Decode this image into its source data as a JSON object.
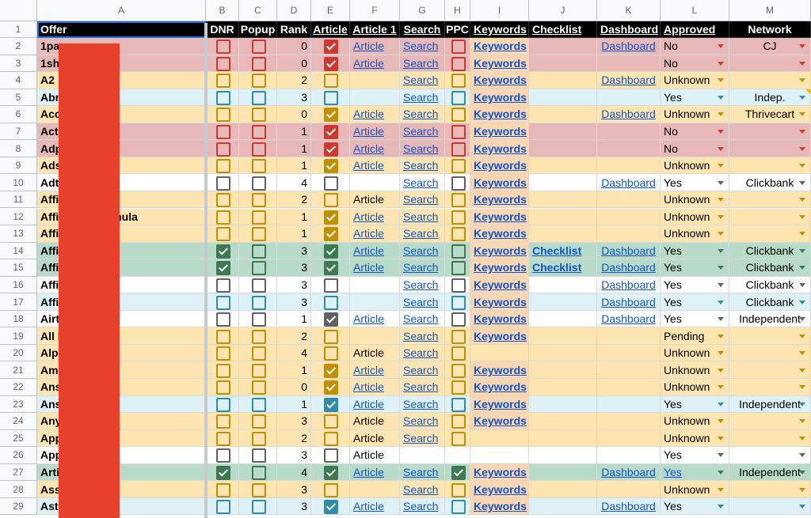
{
  "colors": {
    "red": "#e6b8b7",
    "yellow": "#fce5b0",
    "blue": "#ddf1f7",
    "green": "#b7dbc8",
    "white": "#ffffff",
    "redact": "#e8402a"
  },
  "checkbox_colors": {
    "red": "#cc3a2f",
    "yellow": "#bf9000",
    "blue": "#2f8dab",
    "green": "#3d7a52",
    "white": "#5f6368"
  },
  "col_letters": [
    "A",
    "B",
    "C",
    "D",
    "E",
    "F",
    "G",
    "H",
    "I",
    "J",
    "K",
    "L",
    "M"
  ],
  "header": [
    "Offer",
    "DNR",
    "Popup",
    "Rank",
    "Article",
    "Article 1",
    "Search",
    "PPC",
    "Keywords",
    "Checklist",
    "Dashboard",
    "Approved",
    "Network"
  ],
  "rows": [
    {
      "n": "2",
      "offer": "1pa",
      "theme": "red",
      "dnr": false,
      "popup": false,
      "rank": "0",
      "art": true,
      "art1": "Article",
      "search": "Search",
      "ppc": false,
      "kw": "Keywords",
      "check": "",
      "dash": "Dashboard",
      "appr": "No",
      "net": "CJ"
    },
    {
      "n": "3",
      "offer": "1sh",
      "theme": "red",
      "dnr": false,
      "popup": false,
      "rank": "0",
      "art": true,
      "art1": "Article",
      "search": "Search",
      "ppc": false,
      "kw": "Keywords",
      "check": "",
      "dash": "",
      "appr": "No",
      "net": ""
    },
    {
      "n": "4",
      "offer": "A2",
      "theme": "yellow",
      "dnr": false,
      "popup": false,
      "rank": "2",
      "art": false,
      "art1": "",
      "search": "Search",
      "ppc": false,
      "kw": "Keywords",
      "check": "",
      "dash": "Dashboard",
      "appr": "Unknown",
      "net": ""
    },
    {
      "n": "5",
      "offer": "Abr",
      "theme": "blue",
      "dnr": false,
      "popup": false,
      "rank": "3",
      "art": false,
      "art1": "",
      "search": "Search",
      "ppc": false,
      "kw": "Keywords",
      "check": "",
      "dash": "",
      "appr": "Yes",
      "net": "Indep."
    },
    {
      "n": "6",
      "offer": "Acc",
      "theme": "yellow",
      "dnr": false,
      "popup": false,
      "rank": "0",
      "art": true,
      "art1": "Article",
      "search": "Search",
      "ppc": false,
      "kw": "Keywords",
      "check": "",
      "dash": "Dashboard",
      "appr": "Unknown",
      "net": "Thrivecart"
    },
    {
      "n": "7",
      "offer": "Act                 gn",
      "theme": "red",
      "dnr": false,
      "popup": false,
      "rank": "1",
      "art": true,
      "art1": "Article",
      "search": "Search",
      "ppc": false,
      "kw": "Keywords",
      "check": "",
      "dash": "",
      "appr": "No",
      "net": ""
    },
    {
      "n": "8",
      "offer": "Adp",
      "theme": "red",
      "dnr": false,
      "popup": false,
      "rank": "1",
      "art": true,
      "art1": "Article",
      "search": "Search",
      "ppc": false,
      "kw": "Keywords",
      "check": "",
      "dash": "",
      "appr": "No",
      "net": ""
    },
    {
      "n": "9",
      "offer": "Ads",
      "theme": "yellow",
      "dnr": false,
      "popup": false,
      "rank": "1",
      "art": true,
      "art1": "Article",
      "search": "Search",
      "ppc": false,
      "kw": "Keywords",
      "check": "",
      "dash": "",
      "appr": "Unknown",
      "net": ""
    },
    {
      "n": "10",
      "offer": "Adt",
      "theme": "white",
      "dnr": false,
      "popup": false,
      "rank": "4",
      "art": false,
      "art1": "",
      "search": "Search",
      "ppc": false,
      "kw": "Keywords",
      "check": "",
      "dash": "Dashboard",
      "appr": "Yes",
      "net": "Clickbank"
    },
    {
      "n": "11",
      "offer": "Affi",
      "theme": "yellow",
      "dnr": false,
      "popup": false,
      "rank": "2",
      "art": false,
      "art1": "Article",
      "search": "Search",
      "ppc": false,
      "kw": "Keywords",
      "check": "",
      "dash": "",
      "appr": "Unknown",
      "net": ""
    },
    {
      "n": "12",
      "offer": "Affi                ssion Formula",
      "theme": "yellow",
      "dnr": false,
      "popup": false,
      "rank": "1",
      "art": true,
      "art1": "Article",
      "search": "Search",
      "ppc": false,
      "kw": "Keywords",
      "check": "",
      "dash": "",
      "appr": "Unknown",
      "net": ""
    },
    {
      "n": "13",
      "offer": "Affi                Lab",
      "theme": "yellow",
      "dnr": false,
      "popup": false,
      "rank": "1",
      "art": true,
      "art1": "Article",
      "search": "Search",
      "ppc": false,
      "kw": "Keywords",
      "check": "",
      "dash": "",
      "appr": "Unknown",
      "net": ""
    },
    {
      "n": "14",
      "offer": "Affi",
      "theme": "green",
      "dnr": true,
      "popup": false,
      "rank": "3",
      "art": true,
      "art1": "Article",
      "search": "Search",
      "ppc": false,
      "kw": "Keywords",
      "check": "Checklist",
      "dash": "Dashboard",
      "appr": "Yes",
      "net": "Clickbank"
    },
    {
      "n": "15",
      "offer": "Affi",
      "theme": "green",
      "dnr": true,
      "popup": false,
      "rank": "3",
      "art": true,
      "art1": "Article",
      "search": "Search",
      "ppc": false,
      "kw": "Keywords",
      "check": "Checklist",
      "dash": "Dashboard",
      "appr": "Yes",
      "net": "Clickbank"
    },
    {
      "n": "16",
      "offer": "Affi",
      "theme": "white",
      "dnr": false,
      "popup": false,
      "rank": "3",
      "art": false,
      "art1": "",
      "search": "Search",
      "ppc": false,
      "kw": "Keywords",
      "check": "",
      "dash": "Dashboard",
      "appr": "Yes",
      "net": "Clickbank"
    },
    {
      "n": "17",
      "offer": "Affi",
      "theme": "blue",
      "dnr": false,
      "popup": false,
      "rank": "3",
      "art": false,
      "art1": "",
      "search": "Search",
      "ppc": false,
      "kw": "Keywords",
      "check": "",
      "dash": "Dashboard",
      "appr": "Yes",
      "net": "Clickbank"
    },
    {
      "n": "18",
      "offer": "Airt",
      "theme": "white",
      "dnr": false,
      "popup": false,
      "rank": "1",
      "art": true,
      "art1": "Article",
      "search": "Search",
      "ppc": false,
      "kw": "Keywords",
      "check": "",
      "dash": "Dashboard",
      "appr": "Yes",
      "net": "Independent"
    },
    {
      "n": "19",
      "offer": "All                 Pro",
      "theme": "yellow",
      "dnr": false,
      "popup": false,
      "rank": "2",
      "art": false,
      "art1": "",
      "search": "Search",
      "ppc": false,
      "kw": "Keywords",
      "check": "",
      "dash": "",
      "appr": "Pending",
      "net": ""
    },
    {
      "n": "20",
      "offer": "Alp",
      "theme": "yellow",
      "dnr": false,
      "popup": false,
      "rank": "4",
      "art": false,
      "art1": "Article",
      "search": "Search",
      "ppc": false,
      "kw": "",
      "check": "",
      "dash": "",
      "appr": "Unknown",
      "net": ""
    },
    {
      "n": "21",
      "offer": "Am",
      "theme": "yellow",
      "dnr": false,
      "popup": false,
      "rank": "1",
      "art": true,
      "art1": "Article",
      "search": "Search",
      "ppc": false,
      "kw": "Keywords",
      "check": "",
      "dash": "",
      "appr": "Unknown",
      "net": ""
    },
    {
      "n": "22",
      "offer": "Ans",
      "theme": "yellow",
      "dnr": false,
      "popup": false,
      "rank": "0",
      "art": true,
      "art1": "Article",
      "search": "Search",
      "ppc": false,
      "kw": "Keywords",
      "check": "",
      "dash": "",
      "appr": "Unknown",
      "net": ""
    },
    {
      "n": "23",
      "offer": "Ans                 blic",
      "theme": "blue",
      "dnr": false,
      "popup": false,
      "rank": "1",
      "art": true,
      "art1": "Article",
      "search": "Search",
      "ppc": false,
      "kw": "Keywords",
      "check": "",
      "dash": "",
      "appr": "Yes",
      "net": "Independent"
    },
    {
      "n": "24",
      "offer": "Any",
      "theme": "yellow",
      "dnr": false,
      "popup": false,
      "rank": "3",
      "art": false,
      "art1": "Article",
      "search": "Search",
      "ppc": false,
      "kw": "Keywords",
      "check": "",
      "dash": "",
      "appr": "Unknown",
      "net": ""
    },
    {
      "n": "25",
      "offer": "App                 s",
      "theme": "yellow",
      "dnr": false,
      "popup": false,
      "rank": "2",
      "art": false,
      "art1": "Article",
      "search": "Search",
      "ppc": false,
      "kw": "",
      "check": "",
      "dash": "",
      "appr": "Unknown",
      "net": ""
    },
    {
      "n": "26",
      "offer": "App",
      "theme": "white",
      "dnr": false,
      "popup": false,
      "rank": "3",
      "art": false,
      "art1": "Article",
      "search": "",
      "ppc": null,
      "kw": "",
      "check": "",
      "dash": "",
      "appr": "Yes",
      "net": ""
    },
    {
      "n": "27",
      "offer": "Arti",
      "theme": "green",
      "dnr": true,
      "popup": false,
      "rank": "4",
      "art": true,
      "art1": "Article",
      "search": "Search",
      "ppc": true,
      "kw": "Keywords",
      "check": "",
      "dash": "Dashboard",
      "appr": "Yes",
      "net": "Independent"
    },
    {
      "n": "28",
      "offer": "Ass                 Pro",
      "theme": "yellow",
      "dnr": false,
      "popup": false,
      "rank": "3",
      "art": false,
      "art1": "",
      "search": "Search",
      "ppc": false,
      "kw": "Keywords",
      "check": "",
      "dash": "",
      "appr": "Unknown",
      "net": ""
    },
    {
      "n": "29",
      "offer": "Ast",
      "theme": "blue",
      "dnr": false,
      "popup": false,
      "rank": "3",
      "art": true,
      "art1": "Article",
      "search": "Search",
      "ppc": false,
      "kw": "Keywords",
      "check": "",
      "dash": "Dashboard",
      "appr": "Yes",
      "net": ""
    }
  ]
}
